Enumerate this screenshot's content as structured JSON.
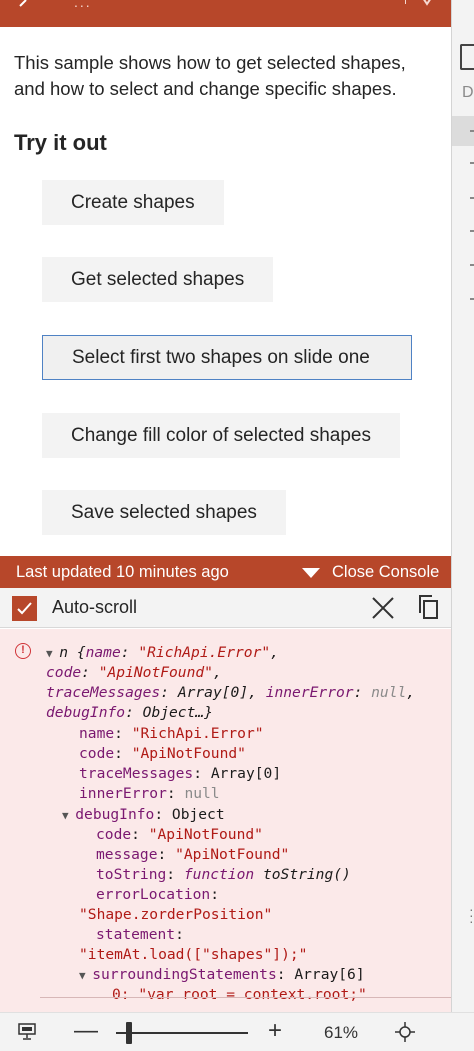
{
  "header": {
    "dots": "...",
    "accent_color": "#b7472a"
  },
  "sidepane": {
    "letter": "D"
  },
  "content": {
    "description": "This sample shows how to get selected shapes, and how to select and change specific shapes.",
    "section_title": "Try it out",
    "buttons": [
      {
        "label": "Create shapes"
      },
      {
        "label": "Get selected shapes"
      },
      {
        "label": "Select first two shapes on slide one"
      },
      {
        "label": "Change fill color of selected shapes"
      },
      {
        "label": "Save selected shapes"
      }
    ]
  },
  "console": {
    "last_updated": "Last updated 10 minutes ago",
    "close_label": "Close Console",
    "autoscroll_label": "Auto-scroll",
    "autoscroll_checked": true,
    "error_icon_glyph": "!",
    "log": {
      "l1a": "n {",
      "l1b": "name",
      "l1c": "\"RichApi.Error\"",
      "l2a": "code",
      "l2b": "\"ApiNotFound\"",
      "l3a": "traceMessages",
      "l3b": "Array[0]",
      "l3c": "innerError",
      "l3d": "null",
      "l4a": "debugInfo",
      "l4b": "Object…}",
      "p_name_k": "name",
      "p_name_v": "\"RichApi.Error\"",
      "p_code_k": "code",
      "p_code_v": "\"ApiNotFound\"",
      "p_trace_k": "traceMessages",
      "p_trace_v": "Array[0]",
      "p_inner_k": "innerError",
      "p_inner_v": "null",
      "p_debug_k": "debugInfo",
      "p_debug_v": "Object",
      "d_code_k": "code",
      "d_code_v": "\"ApiNotFound\"",
      "d_msg_k": "message",
      "d_msg_v": "\"ApiNotFound\"",
      "d_tostr_k": "toString",
      "d_tostr_fn": "function",
      "d_tostr_v": "toString()",
      "d_errloc_k": "errorLocation",
      "d_errloc_v": "\"Shape.zorderPosition\"",
      "d_stmt_k": "statement",
      "d_stmt_v": "\"itemAt.load([\"shapes\"]);\"",
      "d_surr_k": "surroundingStatements",
      "d_surr_v": "Array[6]",
      "d_item0": "0: \"var root = context.root;\""
    }
  },
  "statusbar": {
    "zoom_minus": "—",
    "zoom_plus": "+",
    "zoom_level": "61%",
    "zoom_fraction": 0.1
  }
}
